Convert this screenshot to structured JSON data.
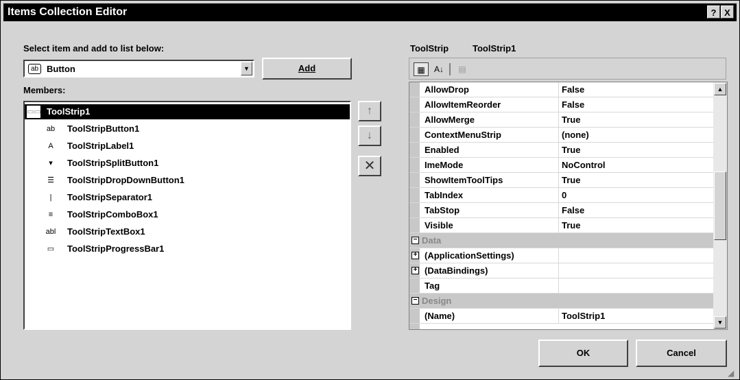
{
  "window": {
    "title": "Items Collection Editor",
    "help_button": "?",
    "close_button": "X"
  },
  "left": {
    "select_label": "Select item and add to list below:",
    "select_label_accel": "S",
    "item_type": {
      "icon": "ab",
      "value": "Button"
    },
    "add_button": "Add",
    "members_label": "Members:",
    "members": [
      {
        "icon": "toolstrip-icon",
        "glyph": "▭▭",
        "label": "ToolStrip1",
        "selected": true,
        "indent": false
      },
      {
        "icon": "button-icon",
        "glyph": "ab",
        "label": "ToolStripButton1"
      },
      {
        "icon": "label-icon",
        "glyph": "A",
        "label": "ToolStripLabel1"
      },
      {
        "icon": "split-button-icon",
        "glyph": "▾",
        "label": "ToolStripSplitButton1"
      },
      {
        "icon": "dropdown-button-icon",
        "glyph": "☰",
        "label": "ToolStripDropDownButton1"
      },
      {
        "icon": "separator-icon",
        "glyph": "|",
        "label": "ToolStripSeparator1"
      },
      {
        "icon": "combobox-icon",
        "glyph": "≡",
        "label": "ToolStripComboBox1"
      },
      {
        "icon": "textbox-icon",
        "glyph": "abl",
        "label": "ToolStripTextBox1"
      },
      {
        "icon": "progressbar-icon",
        "glyph": "▭",
        "label": "ToolStripProgressBar1"
      }
    ],
    "move_up_glyph": "🡅",
    "move_down_glyph": "🡇",
    "delete_glyph": "✕"
  },
  "right": {
    "object_type": "ToolStrip",
    "object_name": "ToolStrip1",
    "properties": [
      {
        "kind": "prop",
        "name": "AllowDrop",
        "value": "False"
      },
      {
        "kind": "prop",
        "name": "AllowItemReorder",
        "value": "False"
      },
      {
        "kind": "prop",
        "name": "AllowMerge",
        "value": "True"
      },
      {
        "kind": "prop",
        "name": "ContextMenuStrip",
        "value": "(none)"
      },
      {
        "kind": "prop",
        "name": "Enabled",
        "value": "True"
      },
      {
        "kind": "prop",
        "name": "ImeMode",
        "value": "NoControl"
      },
      {
        "kind": "prop",
        "name": "ShowItemToolTips",
        "value": "True"
      },
      {
        "kind": "prop",
        "name": "TabIndex",
        "value": "0"
      },
      {
        "kind": "prop",
        "name": "TabStop",
        "value": "False"
      },
      {
        "kind": "prop",
        "name": "Visible",
        "value": "True"
      },
      {
        "kind": "cat",
        "name": "Data",
        "value": "",
        "expander": "−"
      },
      {
        "kind": "exp",
        "name": "(ApplicationSettings)",
        "value": "",
        "expander": "+"
      },
      {
        "kind": "exp",
        "name": "(DataBindings)",
        "value": "",
        "expander": "+"
      },
      {
        "kind": "prop",
        "name": "Tag",
        "value": ""
      },
      {
        "kind": "cat",
        "name": "Design",
        "value": "",
        "expander": "−"
      },
      {
        "kind": "prop",
        "name": "(Name)",
        "value": "ToolStrip1"
      }
    ]
  },
  "footer": {
    "ok": "OK",
    "cancel": "Cancel"
  }
}
